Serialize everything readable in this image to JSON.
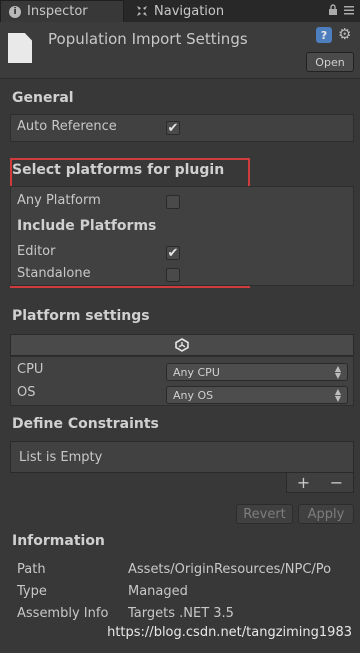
{
  "tabs": [
    {
      "label": "Inspector",
      "icon": "info-icon",
      "active": true
    },
    {
      "label": "Navigation",
      "icon": "navigation-icon",
      "active": false
    }
  ],
  "tab_icons": [
    "lock-icon",
    "menu-icon"
  ],
  "header": {
    "title": "Population Import Settings",
    "open_label": "Open"
  },
  "general": {
    "heading": "General",
    "auto_reference_label": "Auto Reference",
    "auto_reference_checked": true
  },
  "platforms": {
    "heading": "Select platforms for plugin",
    "any_platform_label": "Any Platform",
    "any_platform_checked": false,
    "include_heading": "Include Platforms",
    "editor_label": "Editor",
    "editor_checked": true,
    "standalone_label": "Standalone",
    "standalone_checked": false
  },
  "platform_settings": {
    "heading": "Platform settings",
    "cpu_label": "CPU",
    "cpu_value": "Any CPU",
    "os_label": "OS",
    "os_value": "Any OS"
  },
  "define_constraints": {
    "heading": "Define Constraints",
    "list_empty_text": "List is Empty",
    "plus": "+",
    "minus": "−"
  },
  "buttons": {
    "revert": "Revert",
    "apply": "Apply"
  },
  "information": {
    "heading": "Information",
    "path_label": "Path",
    "path_value": "Assets/OriginResources/NPC/Po",
    "type_label": "Type",
    "type_value": "Managed",
    "assembly_label": "Assembly Info",
    "assembly_value": "Targets .NET 3.5"
  },
  "watermark": "https://blog.csdn.net/tangziming1983"
}
